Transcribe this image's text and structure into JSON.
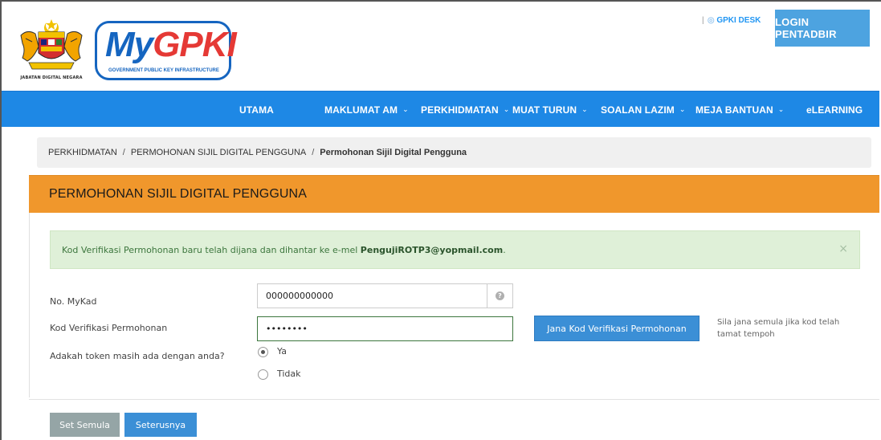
{
  "header": {
    "agency_caption": "JABATAN DIGITAL NEGARA",
    "brand_title_my": "My",
    "brand_title_gpki": "GPKI",
    "brand_subtitle": "GOVERNMENT PUBLIC KEY INFRASTRUCTURE",
    "gpki_desk_label": "GPKI DESK",
    "login_label": "LOGIN PENTADBIR"
  },
  "nav": {
    "items": [
      {
        "label": "UTAMA",
        "has_dropdown": false
      },
      {
        "label": "MAKLUMAT AM",
        "has_dropdown": true
      },
      {
        "label": "PERKHIDMATAN",
        "has_dropdown": true
      },
      {
        "label": "MUAT TURUN",
        "has_dropdown": true
      },
      {
        "label": "SOALAN LAZIM",
        "has_dropdown": true
      },
      {
        "label": "MEJA BANTUAN",
        "has_dropdown": true
      },
      {
        "label": "eLEARNING",
        "has_dropdown": false
      }
    ]
  },
  "breadcrumb": {
    "items": [
      "PERKHIDMATAN",
      "PERMOHONAN SIJIL DIGITAL PENGGUNA",
      "Permohonan Sijil Digital Pengguna"
    ]
  },
  "panel": {
    "title": "PERMOHONAN SIJIL DIGITAL PENGGUNA"
  },
  "alert": {
    "message": "Kod Verifikasi Permohonan baru telah dijana dan dihantar ke e-mel ",
    "email": "PengujiROTP3@yopmail.com",
    "suffix": ".",
    "close_glyph": "×"
  },
  "form": {
    "mykad_label": "No. MyKad",
    "mykad_value": "000000000000",
    "code_label": "Kod Verifikasi Permohonan",
    "code_value": "••••••••",
    "generate_button": "Jana Kod Verifikasi Permohonan",
    "generate_hint": "Sila jana semula jika kod telah tamat tempoh",
    "token_label": "Adakah token masih ada dengan anda?",
    "token_options": [
      {
        "label": "Ya",
        "selected": true
      },
      {
        "label": "Tidak",
        "selected": false
      }
    ]
  },
  "actions": {
    "reset_label": "Set Semula",
    "next_label": "Seterusnya"
  },
  "colors": {
    "nav_bg": "#1e88e5",
    "panel_head_bg": "#f0972c",
    "alert_bg": "#dff0d8",
    "primary_button": "#3b8fd6",
    "reset_button": "#95a5a6"
  }
}
